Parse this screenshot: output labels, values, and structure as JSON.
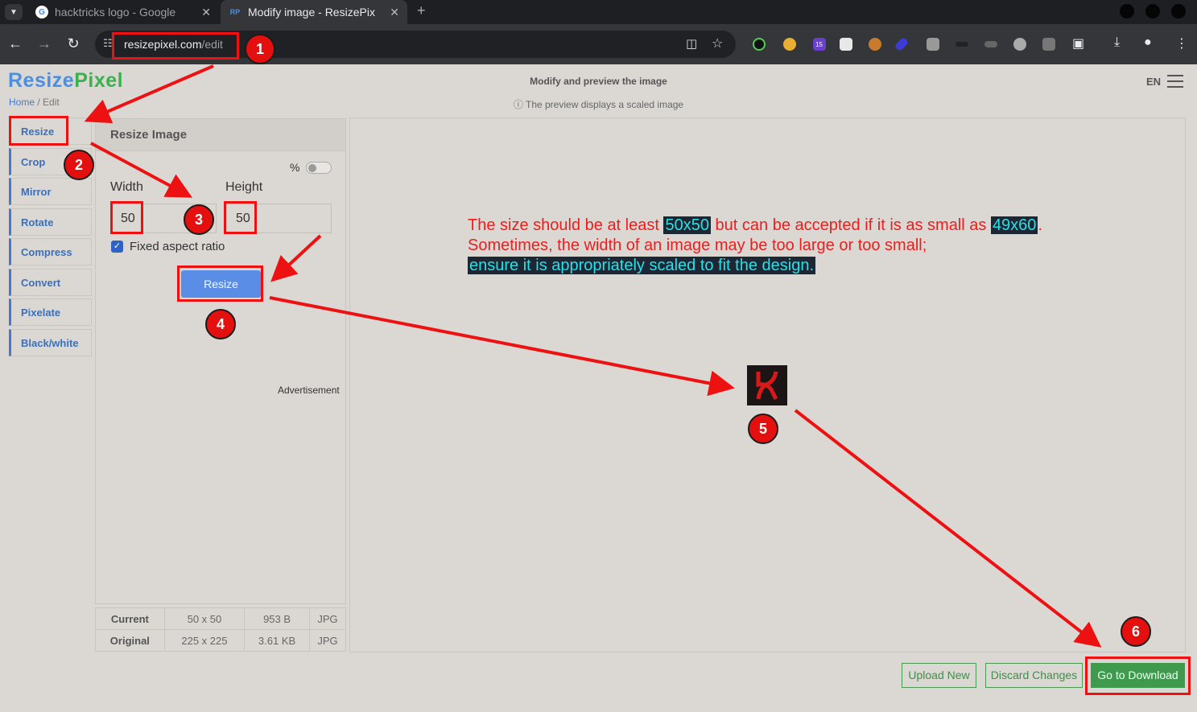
{
  "browser": {
    "tabs": [
      {
        "title": "hacktricks logo - Google",
        "favicon": "G"
      },
      {
        "title": "Modify image - ResizePix",
        "favicon": "RP"
      }
    ],
    "url_host": "resizepixel.com",
    "url_path": "/edit",
    "ext_badge": "15"
  },
  "header": {
    "logo_part1": "Resize",
    "logo_part2": "Pixel",
    "breadcrumb_home": "Home",
    "breadcrumb_current": " / Edit",
    "title": "Modify and preview the image",
    "note": "The preview displays a scaled image",
    "lang": "EN"
  },
  "sidebar": {
    "items": [
      "Resize",
      "Crop",
      "Mirror",
      "Rotate",
      "Compress",
      "Convert",
      "Pixelate",
      "Black/white"
    ]
  },
  "panel": {
    "title": "Resize Image",
    "percent_label": "%",
    "width_label": "Width",
    "height_label": "Height",
    "width_value": "50",
    "height_value": "50",
    "aspect_label": "Fixed aspect ratio",
    "resize_label": "Resize",
    "ad_label": "Advertisement"
  },
  "stats": [
    [
      "Current",
      "50 x 50",
      "953 B",
      "JPG"
    ],
    [
      "Original",
      "225 x 225",
      "3.61 KB",
      "JPG"
    ]
  ],
  "buttons": {
    "upload": "Upload New",
    "discard": "Discard Changes",
    "download": "Go to Download"
  },
  "annotation": {
    "line1_a": "The size should be at least ",
    "line1_hl1": "50x50",
    "line1_b": " but can be accepted if it is as small as ",
    "line1_hl2": "49x60",
    "line1_c": ".",
    "line2": "Sometimes, the width of an image may be too large or too small;",
    "line3": "ensure it is appropriately scaled to fit the design.",
    "badges": [
      "1",
      "2",
      "3",
      "4",
      "5",
      "6"
    ]
  },
  "colors": {
    "annotation_red": "#ee1111",
    "brand_blue": "#4a8fe2",
    "brand_green": "#37b24d",
    "download_green": "#3f9a4e"
  }
}
